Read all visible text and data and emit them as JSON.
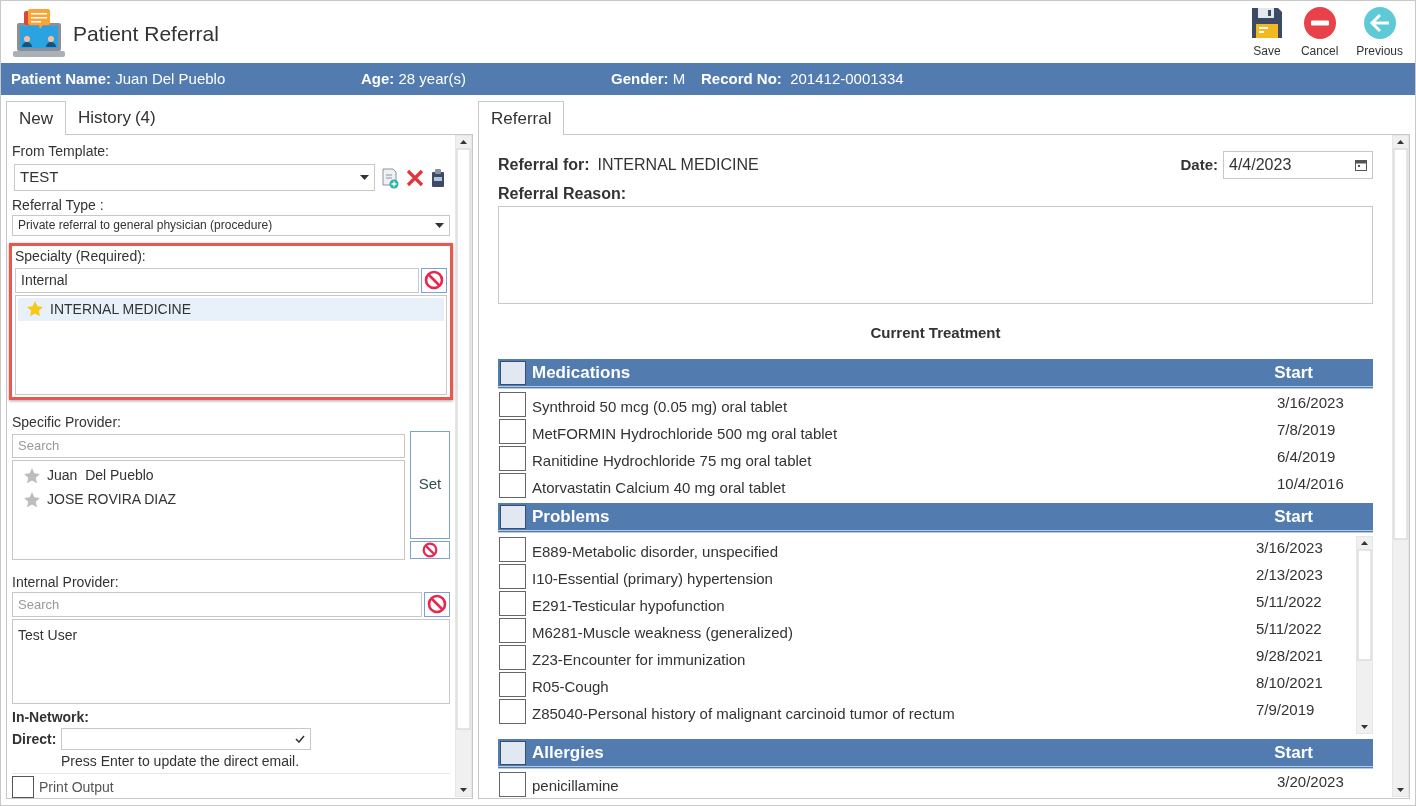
{
  "window": {
    "title": "Patient Referral"
  },
  "toolbar": [
    {
      "kind": "save",
      "label": "Save"
    },
    {
      "kind": "cancel",
      "label": "Cancel"
    },
    {
      "kind": "previous",
      "label": "Previous"
    }
  ],
  "patient_bar": [
    {
      "label": "Patient Name:",
      "value": "Juan Del Pueblo"
    },
    {
      "label": "Age:",
      "value": "28 year(s)"
    },
    {
      "label": "Gender:",
      "value": "M"
    },
    {
      "label": "Record No:",
      "value": "201412-0001334"
    }
  ],
  "left_tabs": [
    {
      "label": "New",
      "selected": true
    },
    {
      "label": "History",
      "count": "(4)",
      "selected": false
    }
  ],
  "form": {
    "template": {
      "label": "From Template:",
      "value": "TEST"
    },
    "referral_type": {
      "label": "Referral Type :",
      "value": "Private referral to general physician (procedure)"
    },
    "specialty": {
      "label": "Specialty (Required):",
      "value": "Internal",
      "highlighted": true,
      "items": [
        {
          "label": "INTERNAL MEDICINE",
          "starred": true,
          "selected": true
        }
      ]
    },
    "specific_provider": {
      "label": "Specific Provider:",
      "placeholder": "Search",
      "button": "Set",
      "items": [
        {
          "label": "Juan  Del Pueblo",
          "starred": false,
          "selected": false
        },
        {
          "label": "JOSE ROVIRA DIAZ",
          "starred": false,
          "selected": false
        }
      ]
    },
    "internal_provider": {
      "label": "Internal Provider:",
      "placeholder": "Search",
      "items": [
        {
          "label": "Test User"
        }
      ]
    },
    "in_network": {
      "label": "In-Network:"
    },
    "direct": {
      "label": "Direct:",
      "hint": "Press Enter to update the direct email."
    },
    "print_output": {
      "label": "Print Output",
      "checked": false
    }
  },
  "right_tabs": [
    {
      "label": "Referral",
      "selected": true
    }
  ],
  "referral": {
    "for_label": "Referral for:",
    "for_value": "INTERNAL MEDICINE",
    "date_label": "Date:",
    "date_value": "4/4/2023",
    "reason_label": "Referral Reason:",
    "treatment_title": "Current Treatment"
  },
  "sections": [
    {
      "title": "Medications",
      "start_label": "Start",
      "checked": false,
      "rows": [
        {
          "name": "Synthroid 50 mcg (0.05 mg) oral tablet",
          "start": "3/16/2023",
          "checked": false
        },
        {
          "name": "MetFORMIN Hydrochloride 500 mg oral tablet",
          "start": "7/8/2019",
          "checked": false
        },
        {
          "name": "Ranitidine Hydrochloride 75 mg oral tablet",
          "start": "6/4/2019",
          "checked": false
        },
        {
          "name": "Atorvastatin Calcium 40 mg oral tablet",
          "start": "10/4/2016",
          "checked": false
        }
      ]
    },
    {
      "title": "Problems",
      "start_label": "Start",
      "checked": false,
      "rows": [
        {
          "name": "E889-Metabolic disorder, unspecified",
          "start": "3/16/2023",
          "checked": false
        },
        {
          "name": "I10-Essential (primary) hypertension",
          "start": "2/13/2023",
          "checked": false
        },
        {
          "name": "E291-Testicular hypofunction",
          "start": "5/11/2022",
          "checked": false
        },
        {
          "name": "M6281-Muscle weakness (generalized)",
          "start": "5/11/2022",
          "checked": false
        },
        {
          "name": "Z23-Encounter for immunization",
          "start": "9/28/2021",
          "checked": false
        },
        {
          "name": "R05-Cough",
          "start": "8/10/2021",
          "checked": false
        },
        {
          "name": "Z85040-Personal history of malignant carcinoid tumor of rectum",
          "start": "7/9/2019",
          "checked": false
        }
      ]
    },
    {
      "title": "Allergies",
      "start_label": "Start",
      "checked": false,
      "rows": [
        {
          "name": "penicillamine",
          "start": "3/20/2023",
          "checked": false
        }
      ]
    }
  ]
}
